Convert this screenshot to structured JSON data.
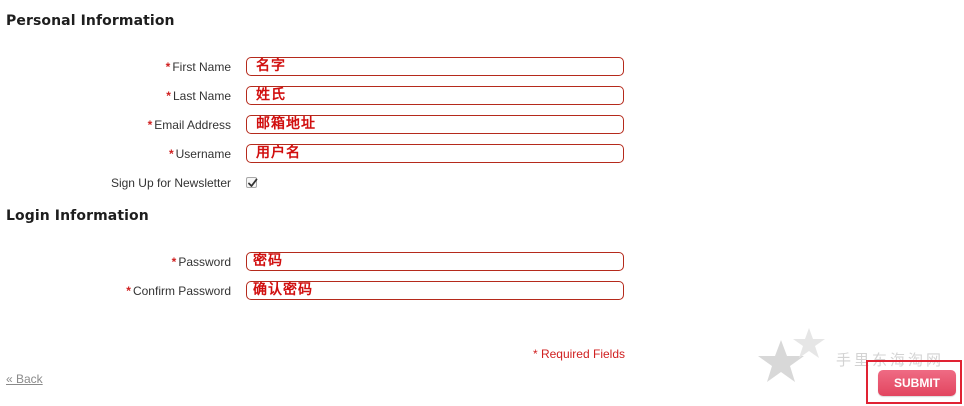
{
  "personal_section": {
    "title": "Personal Information",
    "fields": [
      {
        "label": "First Name",
        "value": "名字",
        "required": true
      },
      {
        "label": "Last Name",
        "value": "姓氏",
        "required": true
      },
      {
        "label": "Email Address",
        "value": "邮箱地址",
        "required": true
      },
      {
        "label": "Username",
        "value": "用户名",
        "required": true
      }
    ],
    "newsletter": {
      "label": "Sign Up for Newsletter",
      "checked": true
    }
  },
  "login_section": {
    "title": "Login Information",
    "fields": [
      {
        "label": "Password",
        "value": "密码",
        "required": true
      },
      {
        "label": "Confirm Password",
        "value": "确认密码",
        "required": true
      }
    ]
  },
  "required_marker": "*",
  "required_note": "* Required Fields",
  "back_link": "« Back",
  "submit_label": "SUBMIT",
  "watermark_text": "手里东海淘网",
  "colors": {
    "required": "#d02020",
    "field_border": "#b52a1c",
    "field_value": "#d10f0f",
    "submit_bg": "#e2455f",
    "highlight_frame": "#e02233"
  }
}
